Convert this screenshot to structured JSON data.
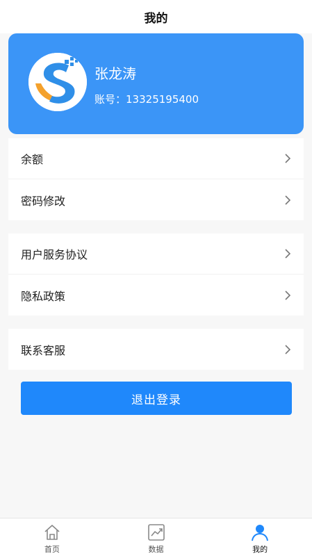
{
  "header": {
    "title": "我的"
  },
  "profile": {
    "name": "张龙涛",
    "account_label": "账号：",
    "account_number": "13325195400"
  },
  "menu_groups": [
    {
      "items": [
        {
          "label": "余额"
        },
        {
          "label": "密码修改"
        }
      ]
    },
    {
      "items": [
        {
          "label": "用户服务协议"
        },
        {
          "label": "隐私政策"
        }
      ]
    },
    {
      "items": [
        {
          "label": "联系客服"
        }
      ]
    }
  ],
  "logout_label": "退出登录",
  "tabs": [
    {
      "label": "首页",
      "icon": "home-icon",
      "active": false
    },
    {
      "label": "数据",
      "icon": "chart-icon",
      "active": false
    },
    {
      "label": "我的",
      "icon": "user-icon",
      "active": true
    }
  ],
  "colors": {
    "accent": "#3b95f7",
    "button": "#1f88fb",
    "background": "#f7f7f7"
  }
}
